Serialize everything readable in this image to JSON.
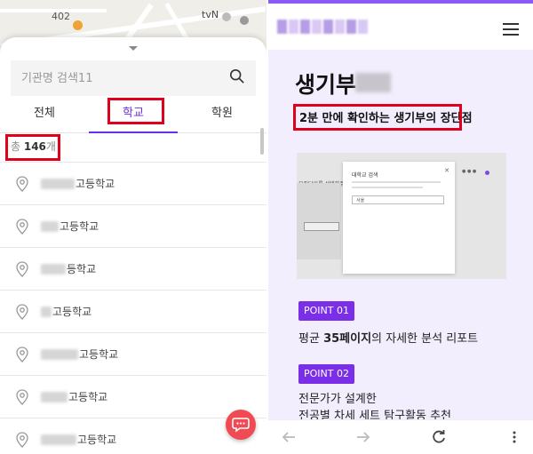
{
  "left": {
    "map": {
      "label_402": "402",
      "label_tvn": "tvN"
    },
    "search": {
      "placeholder": "기관명 검색11",
      "icon": "search-icon"
    },
    "tabs": [
      {
        "label": "전체",
        "active": false
      },
      {
        "label": "학교",
        "active": true
      },
      {
        "label": "학원",
        "active": false
      }
    ],
    "count": {
      "prefix": "총 ",
      "value": "146",
      "suffix": "개"
    },
    "results": [
      {
        "suffix": "고등학교"
      },
      {
        "suffix": "고등학교"
      },
      {
        "suffix": "등학교"
      },
      {
        "suffix": "고등학교"
      },
      {
        "suffix": "고등학교"
      },
      {
        "suffix": "고등학교"
      },
      {
        "suffix": "고등학교"
      }
    ],
    "fab_icon": "chat-icon",
    "colors": {
      "accent": "#6a2ee8",
      "highlight": "#e0001b",
      "fab": "#f04b55"
    }
  },
  "right": {
    "header": {
      "menu_icon": "hamburger-menu-icon"
    },
    "title": "생기부",
    "subtitle": "2분 만에 확인하는 생기부의 장단점",
    "preview": {
      "modal_title": "대학교 검색",
      "field_value": "서울",
      "left_step": "모집단위를 선택해주"
    },
    "points": [
      {
        "badge": "POINT 01",
        "text_a": "평균 ",
        "text_bold": "35페이지",
        "text_b": "의 자세한 분석 리포트"
      },
      {
        "badge": "POINT 02",
        "line1": "전문가가 설계한",
        "line2": "전공별 차세 세트 탐구활동 추천"
      }
    ],
    "nav": {
      "back_icon": "back-arrow-icon",
      "forward_icon": "forward-arrow-icon",
      "reload_icon": "reload-icon",
      "more_icon": "more-vertical-icon"
    },
    "colors": {
      "badge": "#7a2ee8",
      "page_bg": "#f3eefd"
    }
  }
}
